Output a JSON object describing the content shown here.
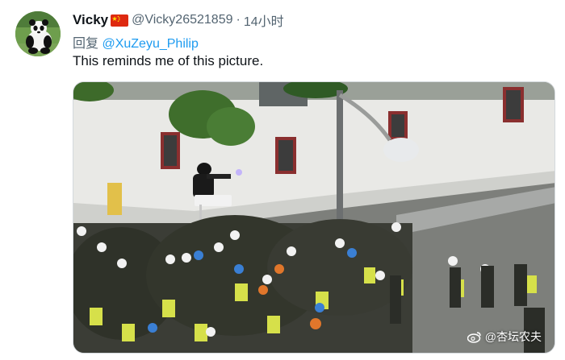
{
  "tweet": {
    "display_name": "Vicky",
    "flag_icon": "china-flag-icon",
    "handle": "@Vicky26521859",
    "separator": "·",
    "time": "14小时",
    "reply_prefix": "回复",
    "reply_to": "@XuZeyu_Philip",
    "text": "This reminds me of this picture.",
    "avatar_icon": "panda-avatar-icon",
    "media": {
      "watermark_icon": "weibo-icon",
      "watermark_text": "@杏坛农夫"
    }
  },
  "colors": {
    "mention": "#1d9bf0",
    "secondary_text": "#536471",
    "primary_text": "#0f1419"
  }
}
